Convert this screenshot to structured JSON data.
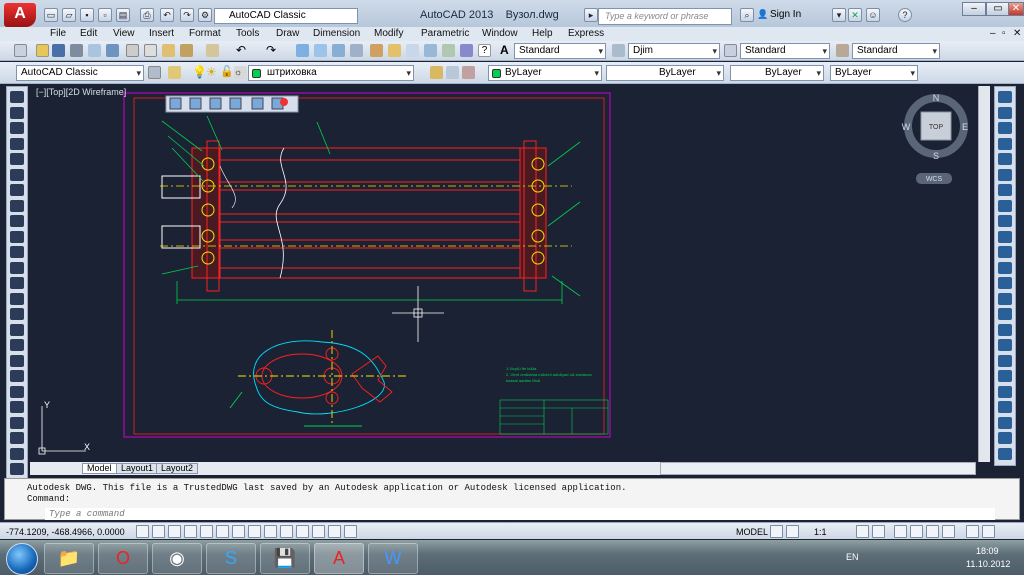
{
  "app": {
    "title": "AutoCAD 2013",
    "filename": "Вузол.dwg",
    "workspace": "AutoCAD Classic",
    "search_placeholder": "Type a keyword or phrase",
    "sign_in": "Sign In",
    "help": "?"
  },
  "menu": [
    "File",
    "Edit",
    "View",
    "Insert",
    "Format",
    "Tools",
    "Draw",
    "Dimension",
    "Modify",
    "Parametric",
    "Window",
    "Help",
    "Express"
  ],
  "styles_toolbar": {
    "text_style": "Standard",
    "dim_style": "Djim",
    "table_style": "Standard",
    "mleader_style": "Standard"
  },
  "layers_toolbar": {
    "workspace": "AutoCAD Classic",
    "layer": "штриховка",
    "color": "ByLayer",
    "linetype": "ByLayer",
    "lineweight": "ByLayer",
    "plotstyle": "ByLayer"
  },
  "viewport": {
    "label": "[−][Top][2D Wireframe]"
  },
  "viewcube": {
    "north": "N",
    "south": "S",
    "east": "E",
    "west": "W",
    "face": "TOP",
    "wcs": "WCS"
  },
  "drawing_notes": {
    "note1": "1.Vicp&i ftn bi&ta",
    "note2": "2. Gent om&iama m&cbnl adn&yad u& shwanoa",
    "note3": "bassat aadtan Mc&"
  },
  "layout_tabs": [
    "Model",
    "Layout1",
    "Layout2"
  ],
  "command": {
    "line1": "Autodesk DWG.  This file is a TrustedDWG last saved by an Autodesk application or Autodesk licensed application.",
    "line2": "Command:",
    "placeholder": "Type a command"
  },
  "status": {
    "coords": "-774.1209, -468.4966, 0.0000",
    "model": "MODEL",
    "scale": "1:1"
  },
  "tray": {
    "lang": "EN",
    "time": "18:09",
    "date": "11.10.2012"
  },
  "colors": {
    "canvas": "#1b2233",
    "red": "#ff2020",
    "green": "#00d050",
    "yellow": "#ffe000",
    "white": "#ffffff",
    "magenta": "#d000d0",
    "cyan": "#00e0ff"
  }
}
